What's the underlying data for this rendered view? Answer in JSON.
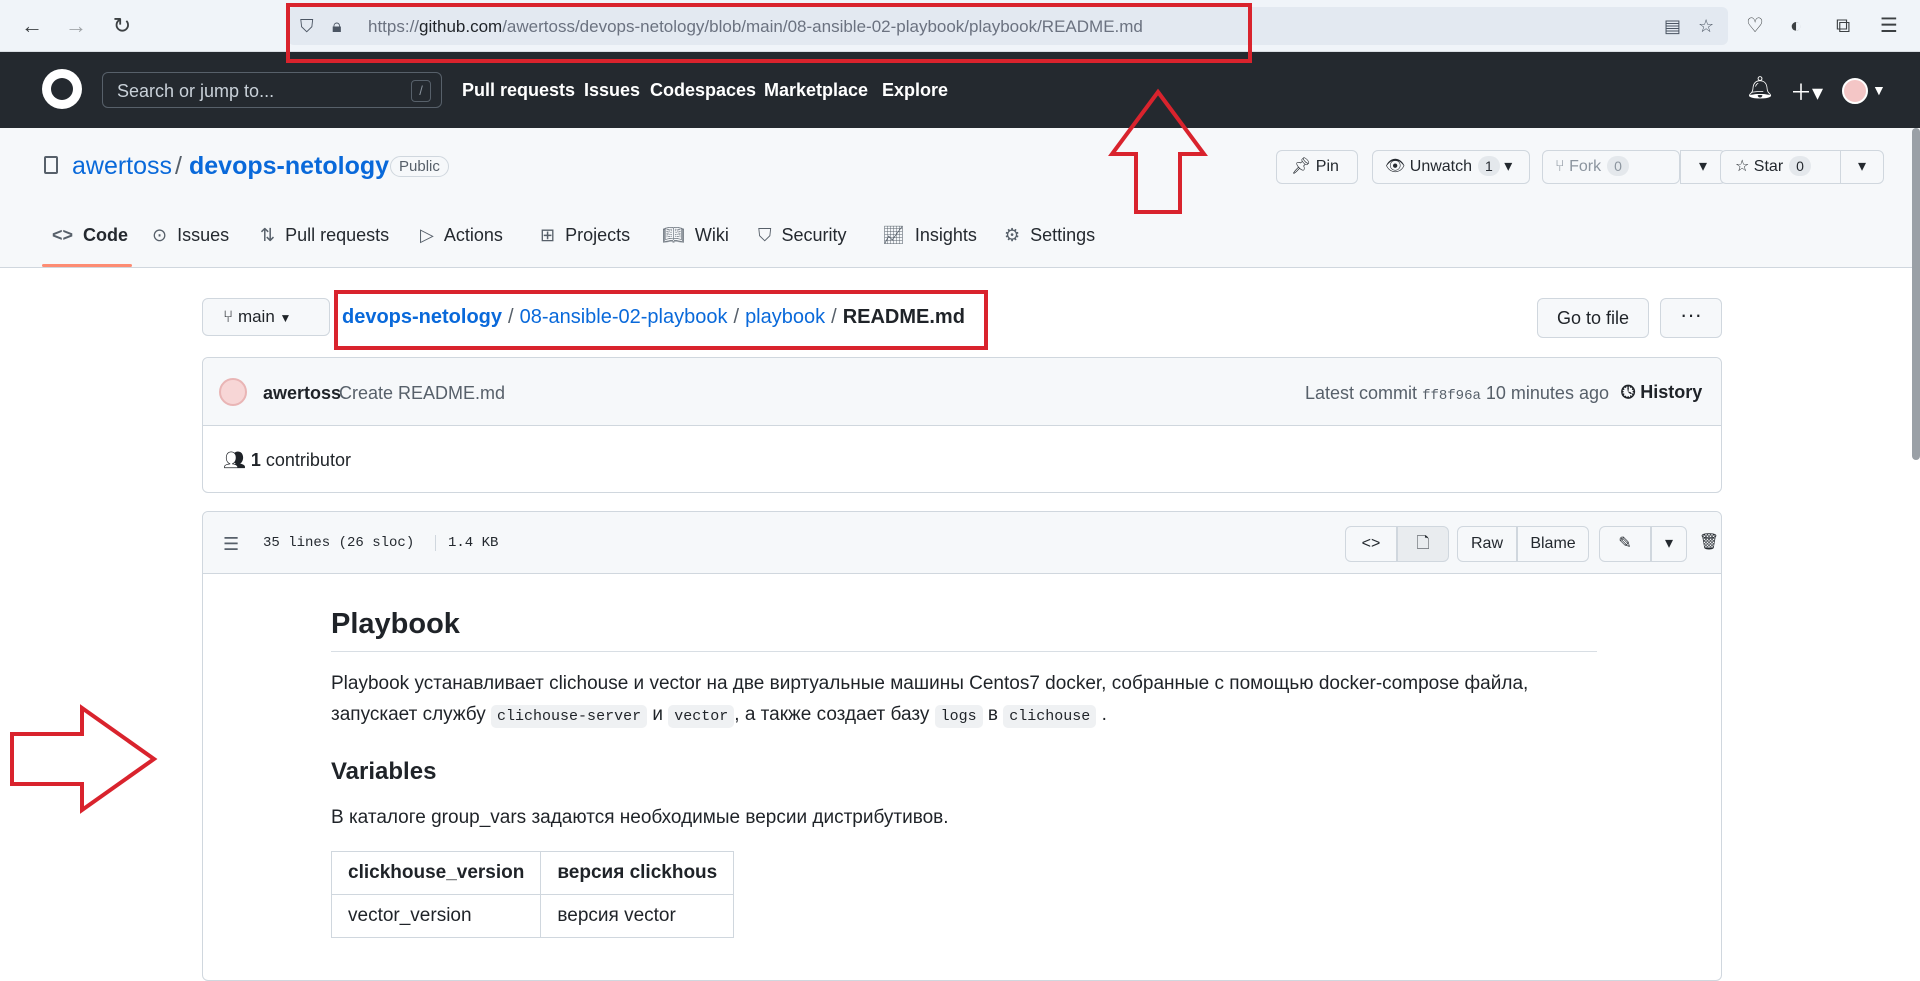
{
  "browser": {
    "url_prefix": "https://",
    "url_host": "github.com",
    "url_path": "/awertoss/devops-netology/blob/main/08-ansible-02-playbook/playbook/README.md"
  },
  "header": {
    "search_placeholder": "Search or jump to...",
    "search_shortcut": "/",
    "nav": [
      "Pull requests",
      "Issues",
      "Codespaces",
      "Marketplace",
      "Explore"
    ]
  },
  "repo": {
    "owner": "awertoss",
    "name": "devops-netology",
    "visibility": "Public",
    "pin_label": "Pin",
    "unwatch_label": "Unwatch",
    "unwatch_count": "1",
    "fork_label": "Fork",
    "fork_count": "0",
    "star_label": "Star",
    "star_count": "0",
    "tabs": [
      "Code",
      "Issues",
      "Pull requests",
      "Actions",
      "Projects",
      "Wiki",
      "Security",
      "Insights",
      "Settings"
    ]
  },
  "file_nav": {
    "branch": "main",
    "crumbs": [
      "devops-netology",
      "08-ansible-02-playbook",
      "playbook"
    ],
    "filename": "README.md",
    "goto_label": "Go to file",
    "more_label": "···"
  },
  "commit": {
    "author": "awertoss",
    "message": "Create README.md",
    "latest_label": "Latest commit",
    "sha": "ff8f96a",
    "time": "10 minutes ago",
    "history_label": "History",
    "contributors_count": "1",
    "contributors_label": "contributor"
  },
  "file": {
    "lines": "35 lines (26 sloc)",
    "size": "1.4 KB",
    "raw_label": "Raw",
    "blame_label": "Blame"
  },
  "readme": {
    "title": "Playbook",
    "intro_text": "Playbook устанавливает clichouse и vector на две виртуальные машины Centos7 docker, собранные с помощью docker-compose файла,",
    "intro_line2_a": "запускает службу",
    "code1": "clichouse-server",
    "intro_and": "и",
    "code2": "vector",
    "intro_line2_b": ", а также создает базу",
    "code3": "logs",
    "intro_in": "в",
    "code4": "clichouse",
    "intro_end": ".",
    "vars_title": "Variables",
    "vars_text": "В каталоге group_vars задаются необходимые версии дистрибутивов.",
    "table": [
      [
        "clickhouse_version",
        "версия clickhous"
      ],
      [
        "vector_version",
        "версия vector"
      ]
    ]
  },
  "colors": {
    "annotation": "#d9232d",
    "link": "#0969da",
    "header_bg": "#24292f"
  }
}
